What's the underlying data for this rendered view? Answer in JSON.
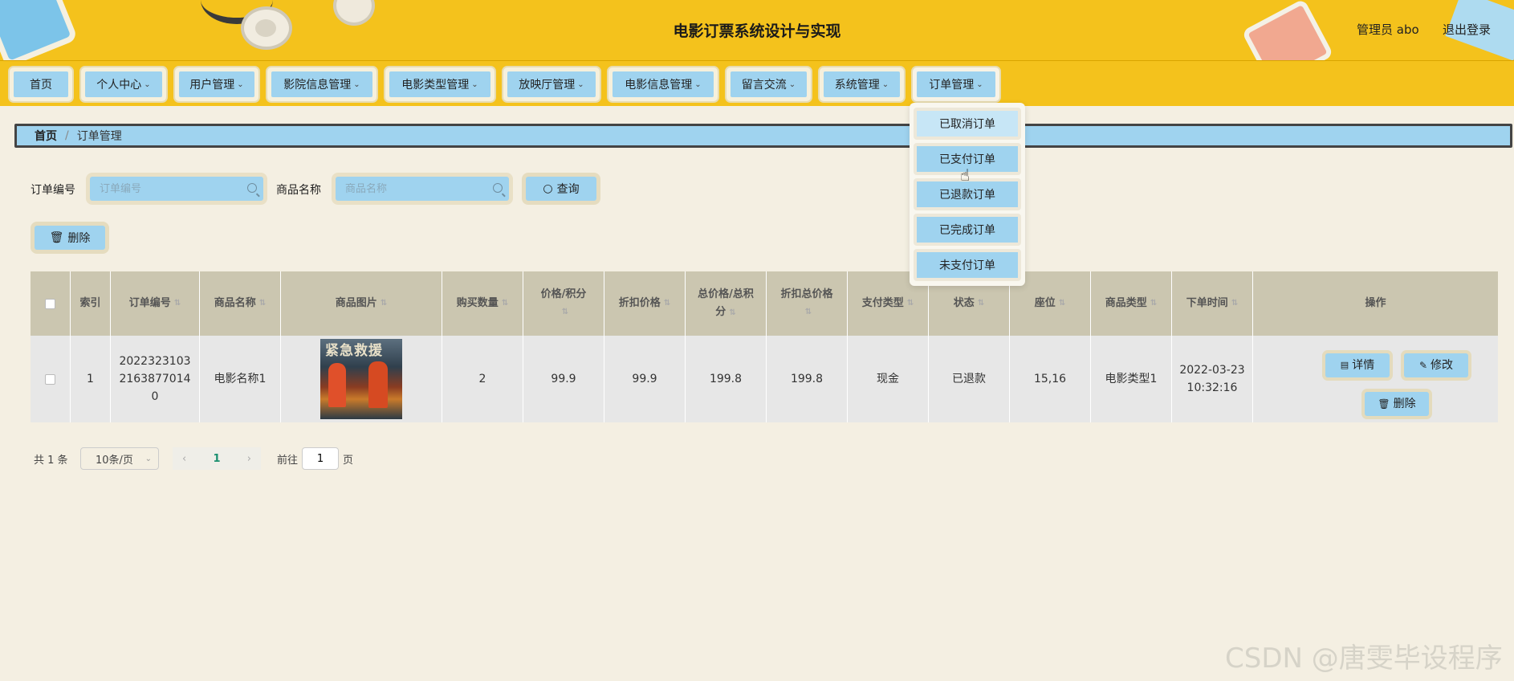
{
  "header": {
    "title": "电影订票系统设计与实现",
    "user": "管理员 abo",
    "logout": "退出登录"
  },
  "nav": {
    "items": [
      {
        "label": "首页",
        "has_dropdown": false
      },
      {
        "label": "个人中心",
        "has_dropdown": true
      },
      {
        "label": "用户管理",
        "has_dropdown": true
      },
      {
        "label": "影院信息管理",
        "has_dropdown": true
      },
      {
        "label": "电影类型管理",
        "has_dropdown": true
      },
      {
        "label": "放映厅管理",
        "has_dropdown": true
      },
      {
        "label": "电影信息管理",
        "has_dropdown": true
      },
      {
        "label": "留言交流",
        "has_dropdown": true
      },
      {
        "label": "系统管理",
        "has_dropdown": true
      },
      {
        "label": "订单管理",
        "has_dropdown": true
      }
    ],
    "dropdown": [
      "已取消订单",
      "已支付订单",
      "已退款订单",
      "已完成订单",
      "未支付订单"
    ]
  },
  "breadcrumb": {
    "home": "首页",
    "separator": "/",
    "current": "订单管理"
  },
  "search": {
    "order_no_label": "订单编号",
    "order_no_placeholder": "订单编号",
    "product_name_label": "商品名称",
    "product_name_placeholder": "商品名称",
    "query_button": "查询",
    "delete_button": "删除"
  },
  "table": {
    "headers": {
      "index": "索引",
      "order_no": "订单编号",
      "product_name": "商品名称",
      "product_image": "商品图片",
      "quantity": "购买数量",
      "price_line1": "价格/积分",
      "discount_price": "折扣价格",
      "total_line1": "总价格/总积",
      "total_line2": "分",
      "discount_total": "折扣总价格",
      "pay_type": "支付类型",
      "status": "状态",
      "seat": "座位",
      "product_type": "商品类型",
      "order_time": "下单时间",
      "actions": "操作"
    },
    "rows": [
      {
        "index": "1",
        "order_no_line1": "2022323103",
        "order_no_line2": "2163877014",
        "order_no_line3": "0",
        "product_name": "电影名称1",
        "poster_text": "紧急救援",
        "quantity": "2",
        "price": "99.9",
        "discount_price": "99.9",
        "total": "199.8",
        "discount_total": "199.8",
        "pay_type": "现金",
        "status": "已退款",
        "seat": "15,16",
        "product_type": "电影类型1",
        "date": "2022-03-23",
        "time": "10:32:16",
        "detail_button": "详情",
        "edit_button": "修改",
        "delete_button": "删除"
      }
    ]
  },
  "pagination": {
    "total": "共 1 条",
    "page_size": "10条/页",
    "current_page": "1",
    "goto_prefix": "前往",
    "goto_value": "1",
    "goto_suffix": "页"
  },
  "watermark": "CSDN @唐雯毕设程序"
}
